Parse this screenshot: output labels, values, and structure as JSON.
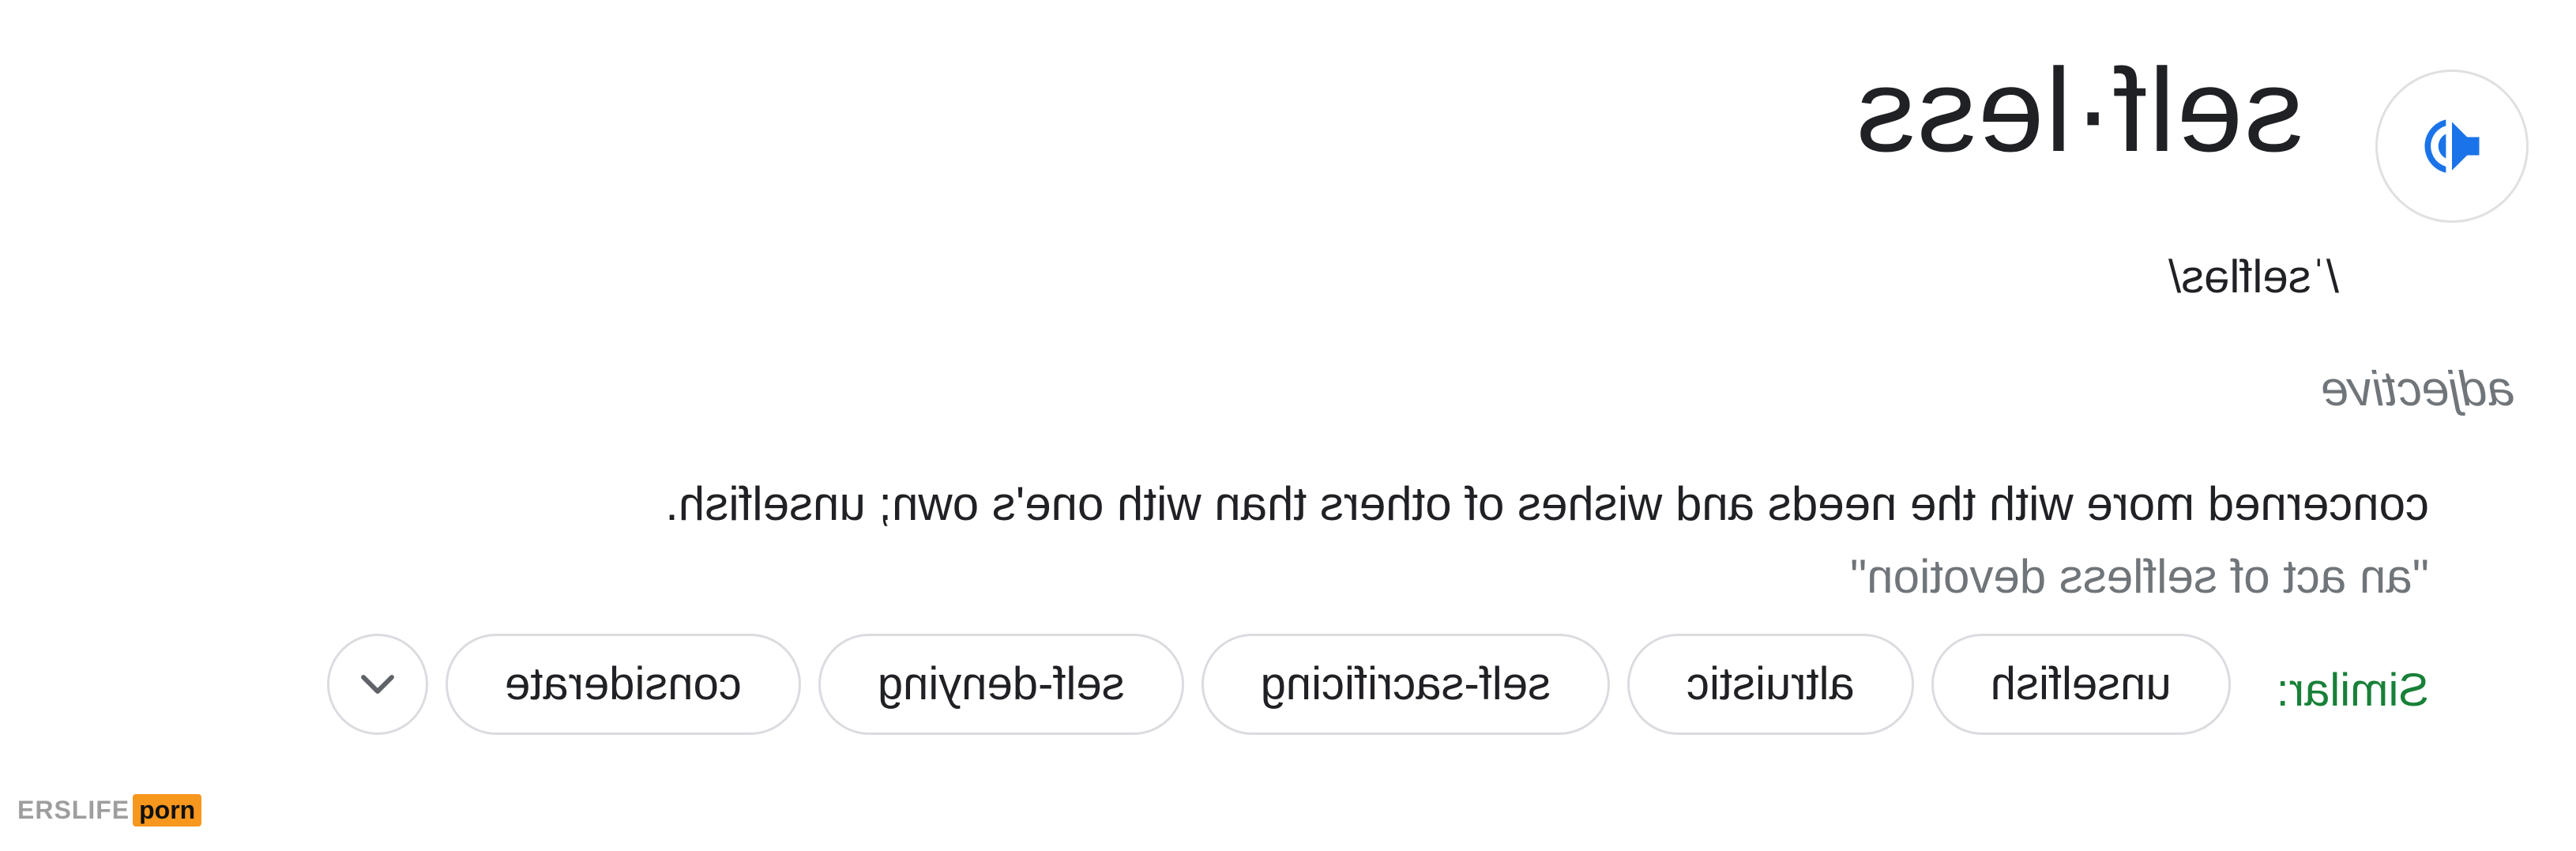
{
  "entry": {
    "headword": "self·less",
    "phonetic": "/ˈselfləs/",
    "part_of_speech": "adjective",
    "definition": "concerned more with the needs and wishes of others than with one's own; unselfish.",
    "example": "\"an act of selfless devotion\"",
    "speaker_icon": "volume-up-icon"
  },
  "similar": {
    "label": "Similar:",
    "chips": [
      "unselfish",
      "altruistic",
      "self-sacrificing",
      "self-denying",
      "considerate"
    ],
    "expand_icon": "chevron-down-icon"
  },
  "watermark": {
    "left_text": "ERSLIFE",
    "right_text": "porn"
  },
  "colors": {
    "accent_blue": "#1a73e8",
    "similar_green": "#188038",
    "muted_gray": "#70757a",
    "chip_border": "#dadce0"
  }
}
